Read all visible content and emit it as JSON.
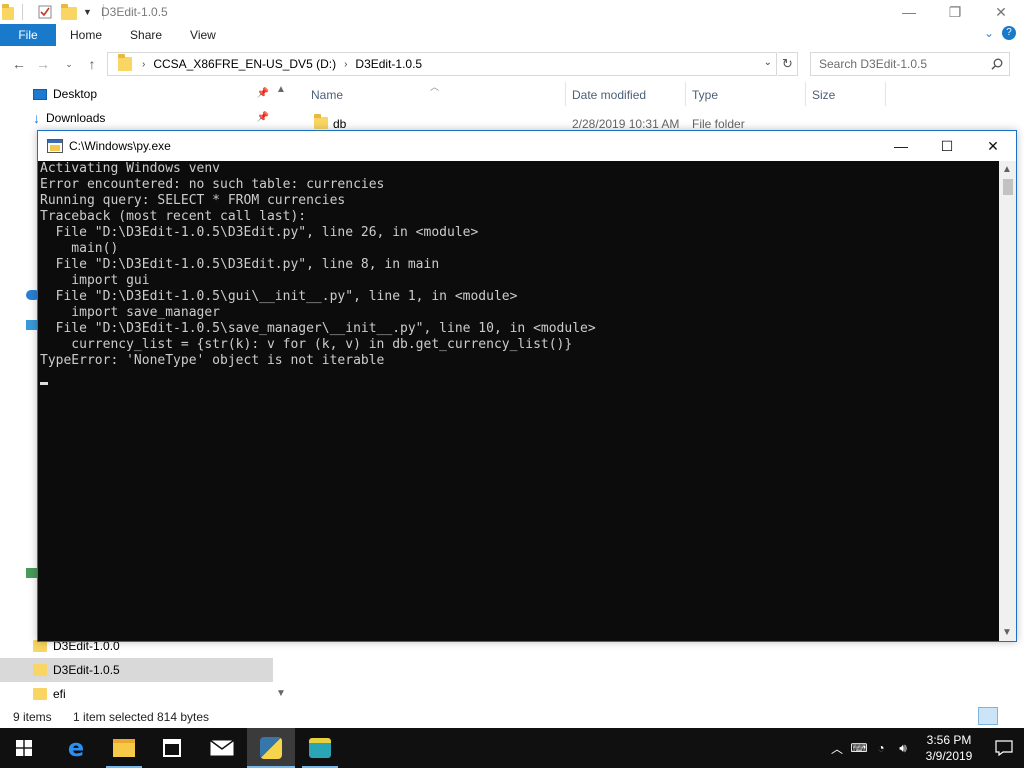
{
  "explorer": {
    "title": "D3Edit-1.0.5",
    "ribbon_tabs": {
      "file": "File",
      "home": "Home",
      "share": "Share",
      "view": "View"
    },
    "address": {
      "drive": "CCSA_X86FRE_EN-US_DV5 (D:)",
      "folder": "D3Edit-1.0.5"
    },
    "search_placeholder": "Search D3Edit-1.0.5",
    "nav": {
      "desktop": "Desktop",
      "downloads": "Downloads",
      "d3edit_100": "D3Edit-1.0.0",
      "d3edit_105": "D3Edit-1.0.5",
      "efi": "efi"
    },
    "columns": {
      "name": "Name",
      "date_modified": "Date modified",
      "type": "Type",
      "size": "Size"
    },
    "files": [
      {
        "name": "db",
        "date": "2/28/2019 10:31 AM",
        "type": "File folder"
      }
    ],
    "status": {
      "items": "9 items",
      "selected": "1 item selected",
      "bytes": "814 bytes"
    }
  },
  "console": {
    "title": "C:\\Windows\\py.exe",
    "lines": [
      "Activating Windows venv",
      "Error encountered: no such table: currencies",
      "Running query: SELECT * FROM currencies",
      "Traceback (most recent call last):",
      "  File \"D:\\D3Edit-1.0.5\\D3Edit.py\", line 26, in <module>",
      "    main()",
      "  File \"D:\\D3Edit-1.0.5\\D3Edit.py\", line 8, in main",
      "    import gui",
      "  File \"D:\\D3Edit-1.0.5\\gui\\__init__.py\", line 1, in <module>",
      "    import save_manager",
      "  File \"D:\\D3Edit-1.0.5\\save_manager\\__init__.py\", line 10, in <module>",
      "    currency_list = {str(k): v for (k, v) in db.get_currency_list()}",
      "TypeError: 'NoneType' object is not iterable"
    ]
  },
  "taskbar": {
    "time": "3:56 PM",
    "date": "3/9/2019"
  },
  "colors": {
    "accent": "#1979ca",
    "console_bg": "#0c0c0c",
    "console_text": "#cccccc",
    "taskbar_bg": "#101010"
  }
}
